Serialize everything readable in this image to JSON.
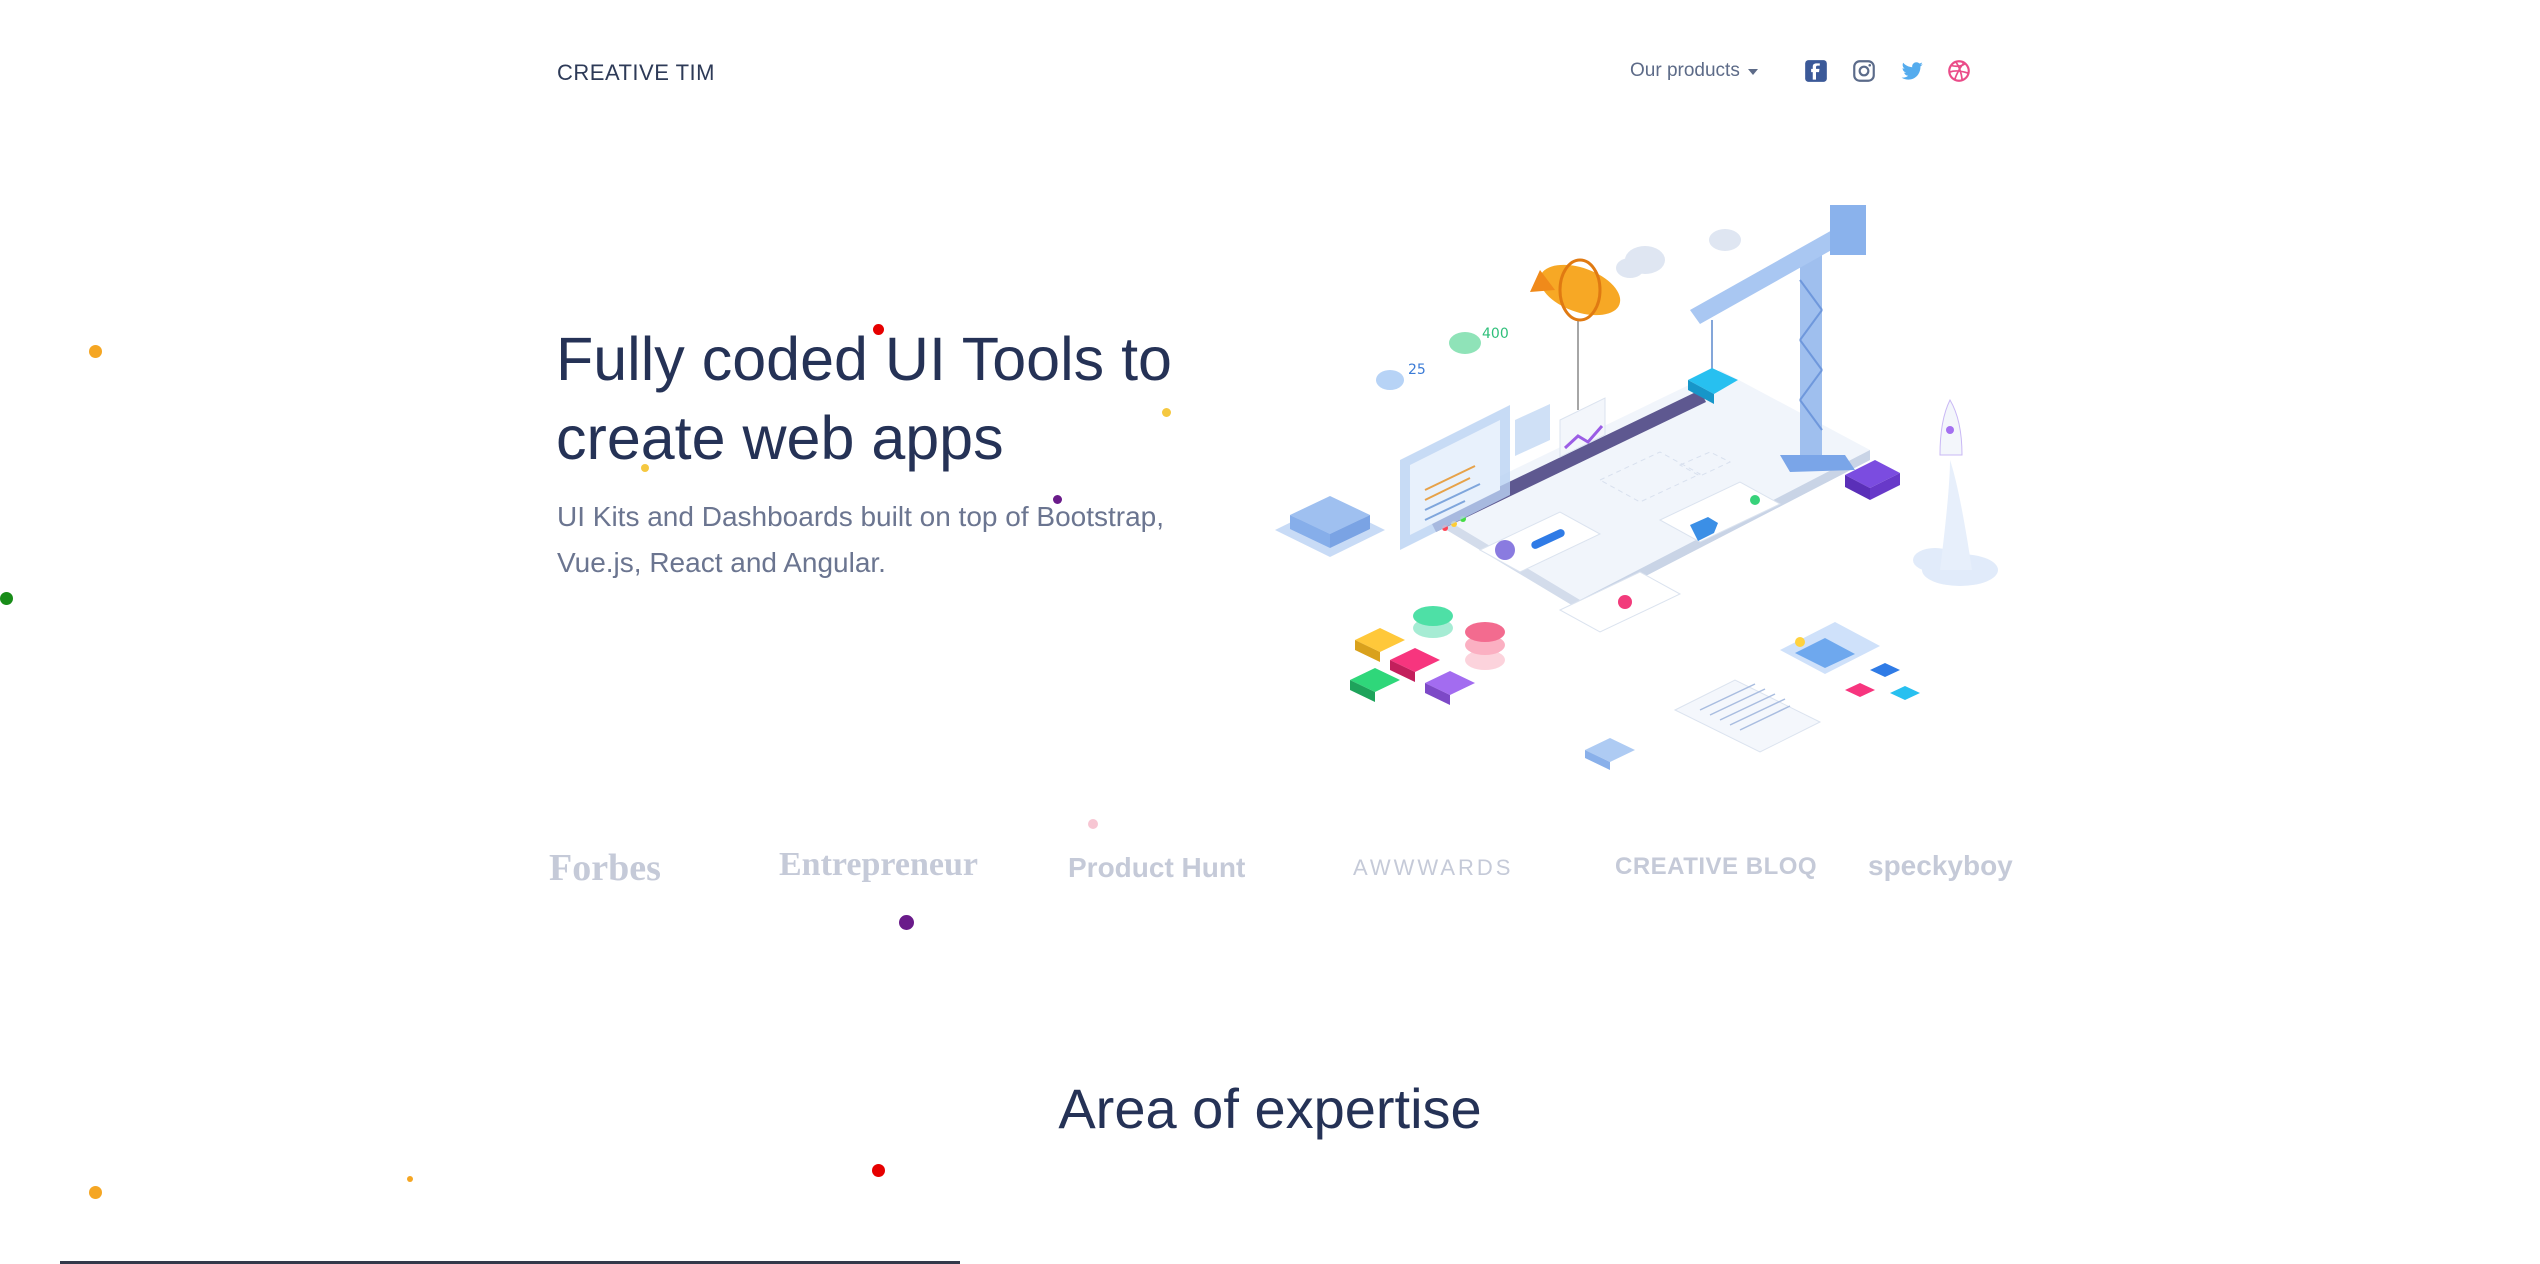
{
  "header": {
    "brand": "CREATIVE TIM",
    "products_label": "Our products",
    "social": [
      {
        "name": "facebook-icon",
        "color": "#3b5998"
      },
      {
        "name": "instagram-icon",
        "color": "#5b6b8a"
      },
      {
        "name": "twitter-icon",
        "color": "#55acee"
      },
      {
        "name": "dribbble-icon",
        "color": "#ea4c89"
      }
    ]
  },
  "hero": {
    "title_line1": "Fully coded UI Tools to",
    "title_line2": "create web apps",
    "subtitle_line1": "UI Kits and Dashboards built on top of Bootstrap,",
    "subtitle_line2": "Vue.js, React and Angular.",
    "illustration_labels": {
      "metric_a": "25",
      "metric_b": "400"
    }
  },
  "press": {
    "logos": [
      "Forbes",
      "Entrepreneur",
      "Product Hunt",
      "AWWWARDS",
      "CREATIVE BLOQ",
      "speckyboy"
    ]
  },
  "sections": {
    "expertise_title": "Area of expertise"
  },
  "colors": {
    "heading": "#253256",
    "muted_logo": "#c5cad8",
    "accent_orange": "#f5a623",
    "accent_red": "#e60000",
    "accent_purple": "#6a1b8a",
    "accent_green": "#188c18"
  }
}
